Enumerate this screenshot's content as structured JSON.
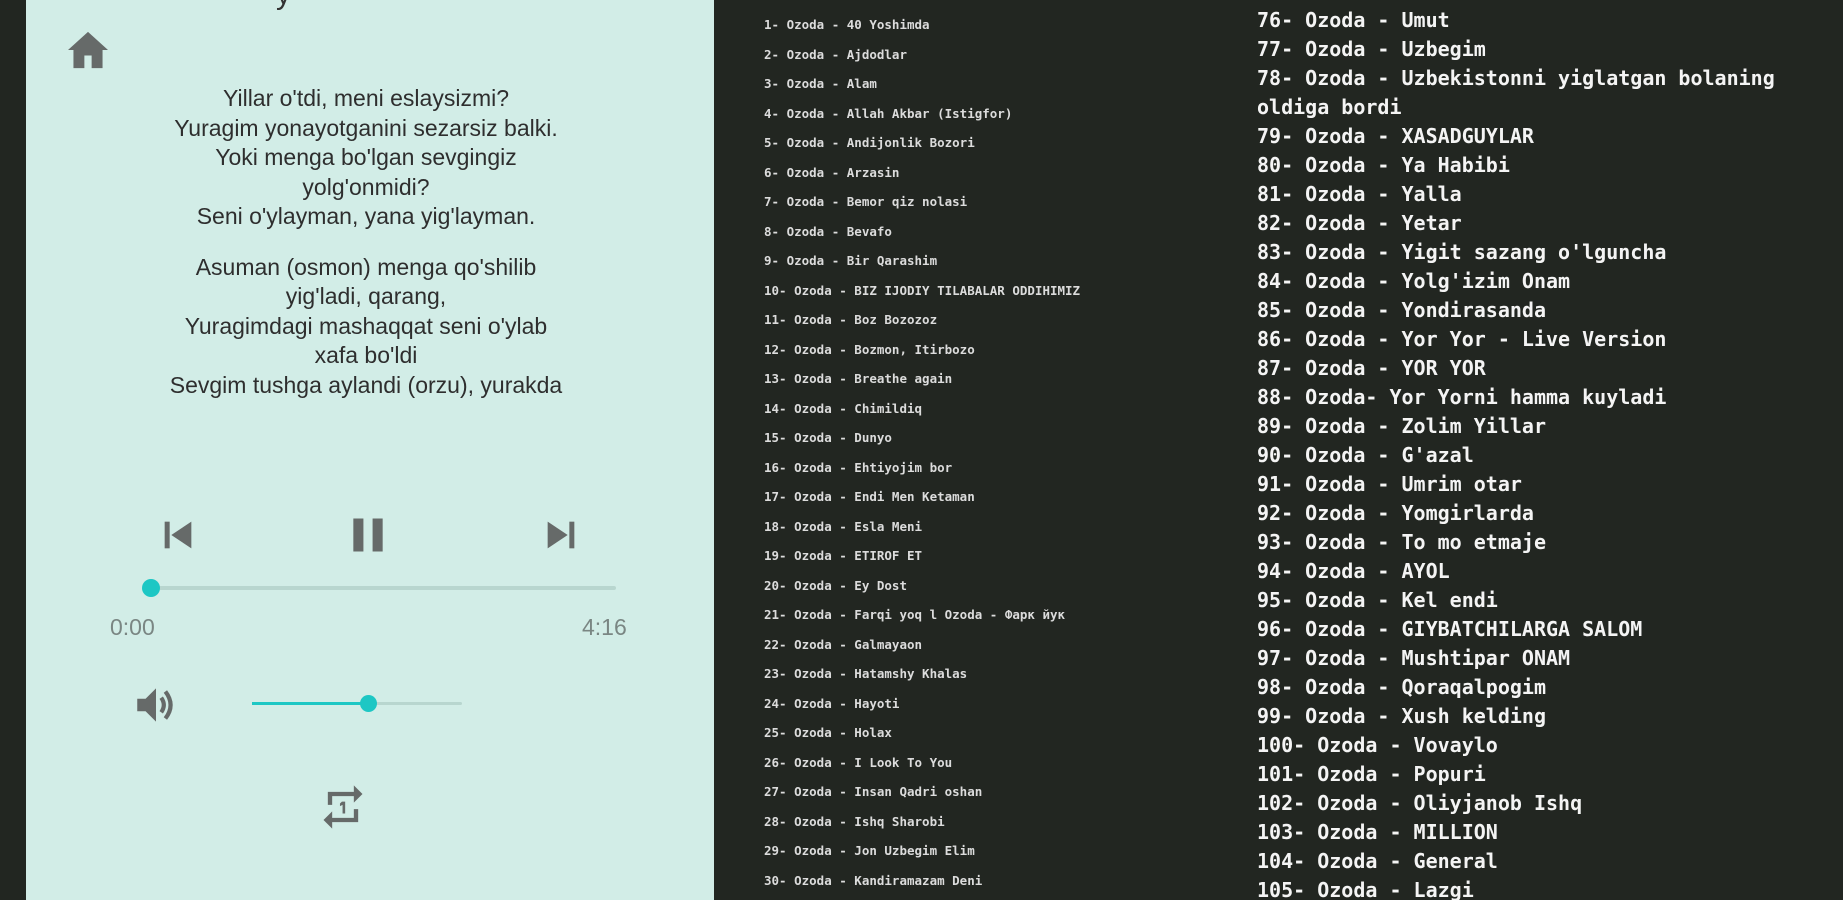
{
  "colors": {
    "accent": "#1dc7c4",
    "player_bg": "#d2ede7",
    "list_bg": "#222621",
    "icon": "#666a69"
  },
  "player": {
    "title_fragment": "y",
    "home_icon": "home-icon",
    "lyrics": [
      [
        "Yillar o'tdi, meni eslaysizmi?",
        "Yuragim yonayotganini sezarsiz balki.",
        "Yoki menga bo'lgan sevgingiz",
        "yolg'onmidi?",
        "Seni o'ylayman, yana yig'layman."
      ],
      [
        "Asuman (osmon) menga qo'shilib",
        "yig'ladi, qarang,",
        "Yuragimdagi mashaqqat seni o'ylab",
        "xafa bo'ldi",
        "Sevgim tushga aylandi (orzu), yurakda",
        "..."
      ]
    ],
    "controls": {
      "prev_icon": "skip-previous-icon",
      "pause_icon": "pause-icon",
      "next_icon": "skip-next-icon"
    },
    "progress": {
      "current": "0:00",
      "total": "4:16",
      "fraction": 0.0
    },
    "volume": {
      "icon": "volume-icon",
      "fraction": 0.55
    },
    "repeat_icon": "repeat-one-icon"
  },
  "playlist": {
    "column1": [
      "1- Ozoda - 40 Yoshimda",
      "2- Ozoda - Ajdodlar",
      "3- Ozoda - Alam",
      "4- Ozoda - Allah Akbar (Istigfor)",
      "5- Ozoda - Andijonlik Bozori",
      "6- Ozoda - Arzasin",
      "7- Ozoda - Bemor qiz nolasi",
      "8- Ozoda - Bevafo",
      "9- Ozoda - Bir Qarashim",
      "10- Ozoda - BIZ IJODIY TILABALAR ODDIHIMIZ",
      "11- Ozoda - Boz Bozozoz",
      "12- Ozoda - Bozmon, Itirbozo",
      "13- Ozoda - Breathe again",
      "14- Ozoda - Chimildiq",
      "15- Ozoda - Dunyo",
      "16- Ozoda - Ehtiyojim bor",
      "17- Ozoda - Endi Men Ketaman",
      "18- Ozoda - Esla Meni",
      "19- Ozoda - ETIROF ET",
      "20- Ozoda - Ey Dost",
      "21- Ozoda - Farqi yoq l Ozoda - Фарк йук",
      "22- Ozoda - Galmayaon",
      "23- Ozoda - Hatamshy Khalas",
      "24- Ozoda - Hayoti",
      "25- Ozoda - Holax",
      "26- Ozoda - I Look To You",
      "27- Ozoda - Insan Qadri oshan",
      "28- Ozoda - Ishq Sharobi",
      "29- Ozoda - Jon Uzbegim Elim",
      "30- Ozoda - Kandiramazam Deni"
    ],
    "column2": [
      "76- Ozoda - Umut",
      "77- Ozoda - Uzbegim",
      "78- Ozoda - Uzbekistonni yiglatgan bolaning oldiga bordi",
      "79- Ozoda - XASADGUYLAR",
      "80- Ozoda - Ya Habibi",
      "81- Ozoda - Yalla",
      "82- Ozoda - Yetar",
      "83- Ozoda - Yigit sazang o'lguncha",
      "84- Ozoda - Yolg'izim Onam",
      "85- Ozoda - Yondirasanda",
      "86- Ozoda - Yor Yor - Live Version",
      "87- Ozoda - YOR YOR",
      "88- Ozoda- Yor Yorni hamma kuyladi",
      "89- Ozoda - Zolim Yillar",
      "90- Ozoda - G'azal",
      "91- Ozoda - Umrim otar",
      "92- Ozoda - Yomgirlarda",
      "93- Ozoda - To mo etmaje",
      "94- Ozoda - AYOL",
      "95- Ozoda - Kel endi",
      "96- Ozoda - GIYBATCHILARGA SALOM",
      "97- Ozoda - Mushtipar ONAM",
      "98- Ozoda - Qoraqalpogim",
      "99- Ozoda - Xush kelding",
      "100- Ozoda - Vovaylo",
      "101- Ozoda - Popuri",
      "102- Ozoda - Oliyjanob Ishq",
      "103- Ozoda - MILLION",
      "104- Ozoda - General",
      "105- Ozoda - Lazgi"
    ]
  }
}
